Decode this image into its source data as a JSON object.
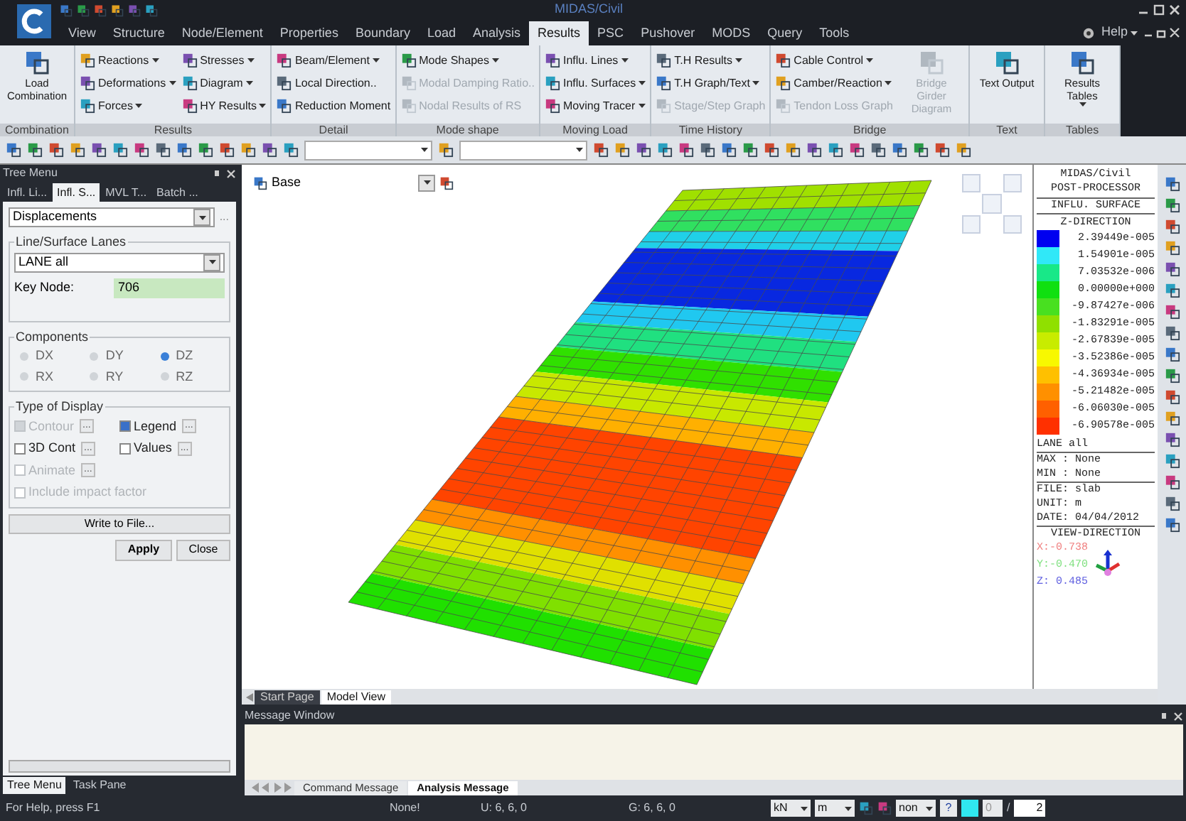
{
  "title_bar": {
    "title": "MIDAS/Civil"
  },
  "menu_tabs": [
    {
      "label": "View",
      "selected": false
    },
    {
      "label": "Structure",
      "selected": false
    },
    {
      "label": "Node/Element",
      "selected": false
    },
    {
      "label": "Properties",
      "selected": false
    },
    {
      "label": "Boundary",
      "selected": false
    },
    {
      "label": "Load",
      "selected": false
    },
    {
      "label": "Analysis",
      "selected": false
    },
    {
      "label": "Results",
      "selected": true
    },
    {
      "label": "PSC",
      "selected": false
    },
    {
      "label": "Pushover",
      "selected": false
    },
    {
      "label": "MODS",
      "selected": false
    },
    {
      "label": "Query",
      "selected": false
    },
    {
      "label": "Tools",
      "selected": false
    }
  ],
  "help": "Help",
  "ribbon_groups": [
    {
      "label": "Combination",
      "columns": [
        [
          {
            "kind": "large",
            "label": "Load Combination",
            "dropdown": false,
            "disabled": false
          }
        ]
      ]
    },
    {
      "label": "Results",
      "columns": [
        [
          {
            "kind": "small",
            "label": "Reactions",
            "dropdown": true,
            "disabled": false
          },
          {
            "kind": "small",
            "label": "Deformations",
            "dropdown": true,
            "disabled": false
          },
          {
            "kind": "small",
            "label": "Forces",
            "dropdown": true,
            "disabled": false
          }
        ],
        [
          {
            "kind": "small",
            "label": "Stresses",
            "dropdown": true,
            "disabled": false
          },
          {
            "kind": "small",
            "label": "Diagram",
            "dropdown": true,
            "disabled": false
          },
          {
            "kind": "small",
            "label": "HY Results",
            "dropdown": true,
            "disabled": false
          }
        ]
      ]
    },
    {
      "label": "Detail",
      "columns": [
        [
          {
            "kind": "small",
            "label": "Beam/Element",
            "dropdown": true,
            "disabled": false
          },
          {
            "kind": "small",
            "label": "Local Direction..",
            "dropdown": false,
            "disabled": false
          },
          {
            "kind": "small",
            "label": "Reduction Moment",
            "dropdown": false,
            "disabled": false
          }
        ]
      ]
    },
    {
      "label": "Mode shape",
      "columns": [
        [
          {
            "kind": "small",
            "label": "Mode Shapes",
            "dropdown": true,
            "disabled": false
          },
          {
            "kind": "small",
            "label": "Modal Damping Ratio..",
            "dropdown": false,
            "disabled": true
          },
          {
            "kind": "small",
            "label": "Nodal Results of RS",
            "dropdown": false,
            "disabled": true
          }
        ]
      ]
    },
    {
      "label": "Moving Load",
      "columns": [
        [
          {
            "kind": "small",
            "label": "Influ. Lines",
            "dropdown": true,
            "disabled": false
          },
          {
            "kind": "small",
            "label": "Influ. Surfaces",
            "dropdown": true,
            "disabled": false
          },
          {
            "kind": "small",
            "label": "Moving Tracer",
            "dropdown": true,
            "disabled": false
          }
        ]
      ]
    },
    {
      "label": "Time History",
      "columns": [
        [
          {
            "kind": "small",
            "label": "T.H Results",
            "dropdown": true,
            "disabled": false
          },
          {
            "kind": "small",
            "label": "T.H Graph/Text",
            "dropdown": true,
            "disabled": false
          },
          {
            "kind": "small",
            "label": "Stage/Step Graph",
            "dropdown": false,
            "disabled": true
          }
        ]
      ]
    },
    {
      "label": "Bridge",
      "columns": [
        [
          {
            "kind": "small",
            "label": "Cable Control",
            "dropdown": true,
            "disabled": false
          },
          {
            "kind": "small",
            "label": "Camber/Reaction",
            "dropdown": true,
            "disabled": false
          },
          {
            "kind": "small",
            "label": "Tendon Loss Graph",
            "dropdown": false,
            "disabled": true
          }
        ],
        [
          {
            "kind": "large",
            "label": "Bridge Girder Diagram",
            "dropdown": false,
            "disabled": true
          }
        ]
      ]
    },
    {
      "label": "Text",
      "columns": [
        [
          {
            "kind": "large",
            "label": "Text Output",
            "dropdown": false,
            "disabled": false
          }
        ]
      ]
    },
    {
      "label": "Tables",
      "columns": [
        [
          {
            "kind": "large",
            "label": "Results Tables",
            "dropdown": true,
            "disabled": false
          }
        ]
      ]
    }
  ],
  "tree_menu": {
    "title": "Tree Menu",
    "tabs": [
      {
        "label": "Infl. Li...",
        "selected": false
      },
      {
        "label": "Infl. S...",
        "selected": true
      },
      {
        "label": "MVL T...",
        "selected": false
      },
      {
        "label": "Batch ...",
        "selected": false
      }
    ],
    "result_type": {
      "value": "Displacements",
      "options_button": "..."
    },
    "lanes": {
      "title": "Line/Surface Lanes",
      "value": "LANE all",
      "key_node_label": "Key Node:",
      "key_node": "706"
    },
    "components": {
      "title": "Components",
      "options": [
        {
          "label": "DX",
          "selected": false
        },
        {
          "label": "DY",
          "selected": false
        },
        {
          "label": "DZ",
          "selected": true
        },
        {
          "label": "RX",
          "selected": false
        },
        {
          "label": "RY",
          "selected": false
        },
        {
          "label": "RZ",
          "selected": false
        }
      ]
    },
    "display": {
      "title": "Type of Display",
      "options": [
        {
          "label": "Contour",
          "checked": true,
          "disabled": true,
          "options_button": "..."
        },
        {
          "label": "Legend",
          "checked": true,
          "disabled": false,
          "options_button": "..."
        },
        {
          "label": "3D Cont",
          "checked": false,
          "disabled": false,
          "options_button": "..."
        },
        {
          "label": "Values",
          "checked": false,
          "disabled": false,
          "options_button": "..."
        },
        {
          "label": "Animate",
          "checked": false,
          "disabled": true,
          "options_button": "..."
        },
        {
          "label": "Include impact factor",
          "checked": false,
          "disabled": true
        }
      ]
    },
    "write_button": "Write to File...",
    "apply_button": "Apply",
    "close_button": "Close",
    "bottom_tabs": [
      {
        "label": "Tree Menu",
        "selected": true
      },
      {
        "label": "Task Pane",
        "selected": false
      }
    ]
  },
  "view": {
    "layer": "Base",
    "legend": {
      "header": [
        "MIDAS/Civil",
        "POST-PROCESSOR"
      ],
      "type": "INFLU. SURFACE",
      "direction": "Z-DIRECTION",
      "entries": [
        {
          "value": "2.39449e-005",
          "color": "#0000f0"
        },
        {
          "value": "1.54901e-005",
          "color": "#30e8f8"
        },
        {
          "value": "7.03532e-006",
          "color": "#18e888"
        },
        {
          "value": "0.00000e+000",
          "color": "#10e010"
        },
        {
          "value": "-9.87427e-006",
          "color": "#48e020"
        },
        {
          "value": "-1.83291e-005",
          "color": "#90e000"
        },
        {
          "value": "-2.67839e-005",
          "color": "#c8ec00"
        },
        {
          "value": "-3.52386e-005",
          "color": "#f8f800"
        },
        {
          "value": "-4.36934e-005",
          "color": "#ffc000"
        },
        {
          "value": "-5.21482e-005",
          "color": "#ff9000"
        },
        {
          "value": "-6.06030e-005",
          "color": "#ff6000"
        },
        {
          "value": "-6.90578e-005",
          "color": "#ff3000"
        }
      ],
      "lane": "LANE all",
      "info": [
        "MAX : None",
        "MIN : None"
      ],
      "file_info": [
        "FILE: slab",
        "UNIT: m",
        "DATE: 04/04/2012"
      ],
      "view_direction": "VIEW-DIRECTION",
      "axes": [
        {
          "label": "X:-0.738",
          "color": "#f08080"
        },
        {
          "label": "Y:-0.470",
          "color": "#80e080"
        },
        {
          "label": "Z: 0.485",
          "color": "#6060e0"
        }
      ]
    },
    "tabs": [
      {
        "label": "Start Page",
        "selected": false
      },
      {
        "label": "Model View",
        "selected": true
      }
    ]
  },
  "message_window": {
    "title": "Message Window",
    "tabs": [
      {
        "label": "Command Message",
        "selected": false
      },
      {
        "label": "Analysis Message",
        "selected": true
      }
    ]
  },
  "status_bar": {
    "help": "For Help, press F1",
    "selection": "None!",
    "ucs": "U: 6, 6, 0",
    "gcs": "G: 6, 6, 0",
    "force_unit": "kN",
    "length_unit": "m",
    "snap": "non",
    "help_button": "?",
    "step": "0",
    "separator": "/",
    "count": "2"
  }
}
